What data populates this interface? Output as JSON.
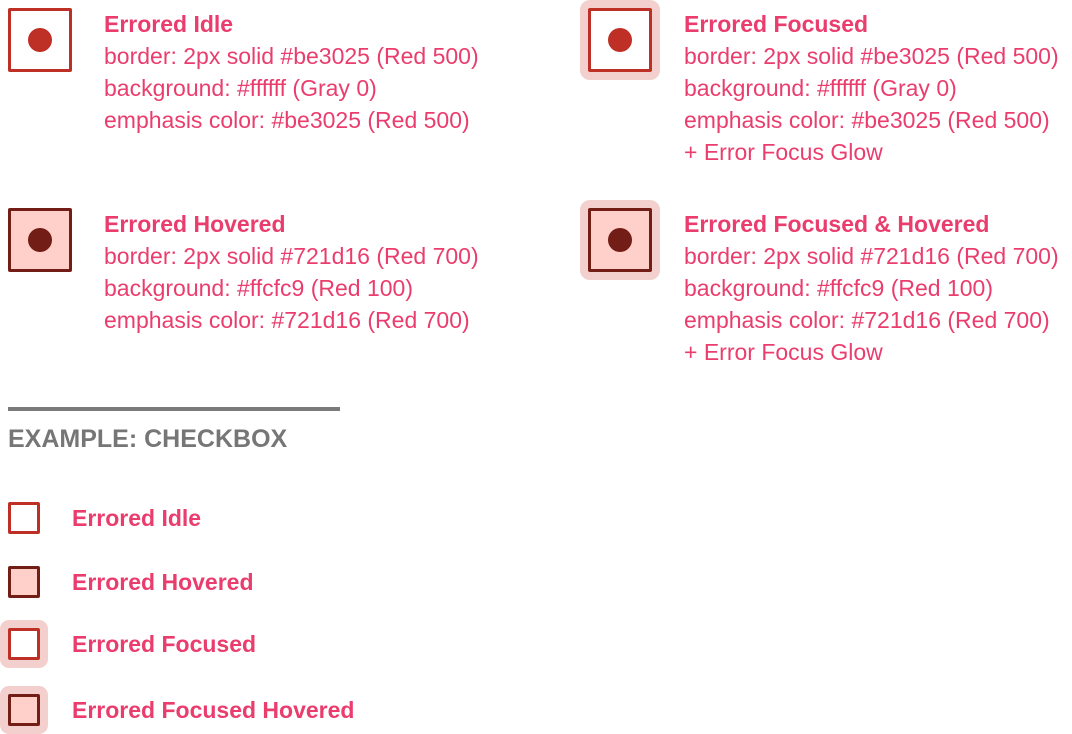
{
  "colors": {
    "text": "#ea3d6d",
    "red500": "#be3025",
    "red700": "#721d16",
    "red100": "#ffcfc9",
    "gray0": "#ffffff",
    "glow": "#f3d0cd",
    "heading": "#767676",
    "divider": "#7a7a7a"
  },
  "specs": [
    {
      "title": "Errored Idle",
      "lines": [
        "border: 2px solid #be3025 (Red 500)",
        "background: #ffffff (Gray 0)",
        "emphasis color: #be3025 (Red 500)"
      ]
    },
    {
      "title": "Errored Focused",
      "lines": [
        "border: 2px solid #be3025 (Red 500)",
        "background: #ffffff (Gray 0)",
        "emphasis color: #be3025 (Red 500)",
        "+ Error Focus Glow"
      ]
    },
    {
      "title": "Errored Hovered",
      "lines": [
        "border: 2px solid #721d16 (Red 700)",
        "background: #ffcfc9 (Red 100)",
        "emphasis color: #721d16 (Red 700)"
      ]
    },
    {
      "title": "Errored Focused & Hovered",
      "lines": [
        "border: 2px solid #721d16 (Red 700)",
        "background: #ffcfc9 (Red 100)",
        "emphasis color: #721d16 (Red 700)",
        "+ Error Focus Glow"
      ]
    }
  ],
  "example": {
    "heading": "EXAMPLE: CHECKBOX",
    "items": [
      {
        "label": "Errored Idle"
      },
      {
        "label": "Errored Hovered"
      },
      {
        "label": "Errored Focused"
      },
      {
        "label": "Errored Focused Hovered"
      }
    ]
  }
}
